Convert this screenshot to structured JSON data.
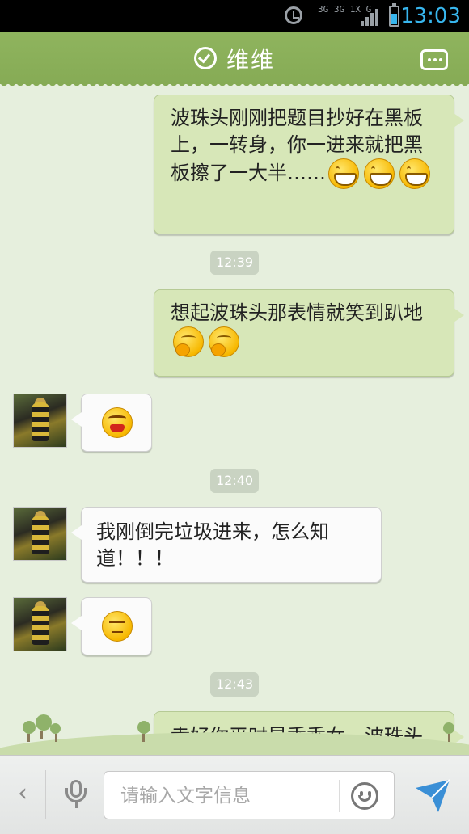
{
  "status_bar": {
    "time": "13:03",
    "network_label": "3G 3G 1X G",
    "battery_level": 0.6,
    "signal_bars": 4
  },
  "header": {
    "title": "维维",
    "left_icon": "check-circle-icon",
    "right_icon": "more-options-icon"
  },
  "messages": [
    {
      "side": "out",
      "text": "波珠头刚刚把题目抄好在黑板上，一转身，你一进来就把黑板擦了一大半……",
      "emojis": [
        "grin",
        "grin",
        "grin"
      ]
    },
    {
      "type": "time",
      "text": "12:39"
    },
    {
      "side": "out",
      "text": "想起波珠头那表情就笑到趴地",
      "emojis": [
        "shy",
        "shy"
      ]
    },
    {
      "side": "in",
      "text": "",
      "emojis": [
        "angry"
      ]
    },
    {
      "type": "time",
      "text": "12:40"
    },
    {
      "side": "in",
      "text": "我刚倒完垃圾进来，怎么知道！！！",
      "emojis": []
    },
    {
      "side": "in",
      "text": "",
      "emojis": [
        "smug"
      ]
    },
    {
      "type": "time",
      "text": "12:43"
    },
    {
      "side": "out",
      "text": "幸好你平时是乖乖女，波珠头也没罚你",
      "emojis": []
    }
  ],
  "input_bar": {
    "placeholder": "请输入文字信息",
    "value": "",
    "back_glyph": "‹"
  },
  "colors": {
    "header_bg": "#8bb05a",
    "chat_bg": "#e6efdd",
    "outgoing_bubble": "#d7e7b8",
    "incoming_bubble": "#fbfbfb",
    "time_chip": "#c9d3c2",
    "status_time": "#38b6ee",
    "send_icon": "#3a8fd6"
  }
}
